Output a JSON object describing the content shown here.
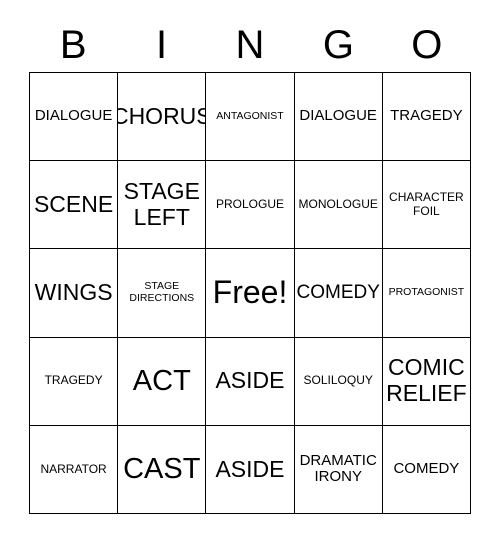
{
  "card": {
    "headers": [
      "B",
      "I",
      "N",
      "G",
      "O"
    ],
    "rows": [
      [
        {
          "label": "DIALOGUE",
          "size": "fs-m"
        },
        {
          "label": "CHORUS",
          "size": "fs-xl"
        },
        {
          "label": "ANTAGONIST",
          "size": "fs-xs"
        },
        {
          "label": "DIALOGUE",
          "size": "fs-m"
        },
        {
          "label": "TRAGEDY",
          "size": "fs-m"
        }
      ],
      [
        {
          "label": "SCENE",
          "size": "fs-xl"
        },
        {
          "label": "STAGE\nLEFT",
          "size": "fs-xl"
        },
        {
          "label": "PROLOGUE",
          "size": "fs-s"
        },
        {
          "label": "MONOLOGUE",
          "size": "fs-s"
        },
        {
          "label": "CHARACTER\nFOIL",
          "size": "fs-s"
        }
      ],
      [
        {
          "label": "WINGS",
          "size": "fs-xl"
        },
        {
          "label": "STAGE\nDIRECTIONS",
          "size": "fs-xs"
        },
        {
          "label": "Free!",
          "size": "fs-free"
        },
        {
          "label": "COMEDY",
          "size": "fs-l"
        },
        {
          "label": "PROTAGONIST",
          "size": "fs-xs"
        }
      ],
      [
        {
          "label": "TRAGEDY",
          "size": "fs-s"
        },
        {
          "label": "ACT",
          "size": "fs-xxl"
        },
        {
          "label": "ASIDE",
          "size": "fs-xl"
        },
        {
          "label": "SOLILOQUY",
          "size": "fs-s"
        },
        {
          "label": "COMIC\nRELIEF",
          "size": "fs-xl"
        }
      ],
      [
        {
          "label": "NARRATOR",
          "size": "fs-s"
        },
        {
          "label": "CAST",
          "size": "fs-xxl"
        },
        {
          "label": "ASIDE",
          "size": "fs-xl"
        },
        {
          "label": "DRAMATIC\nIRONY",
          "size": "fs-m"
        },
        {
          "label": "COMEDY",
          "size": "fs-m"
        }
      ]
    ],
    "free_space": {
      "row": 2,
      "col": 2,
      "label": "Free!"
    },
    "colors": {
      "background": "#ffffff",
      "text": "#000000",
      "border": "#000000"
    }
  }
}
